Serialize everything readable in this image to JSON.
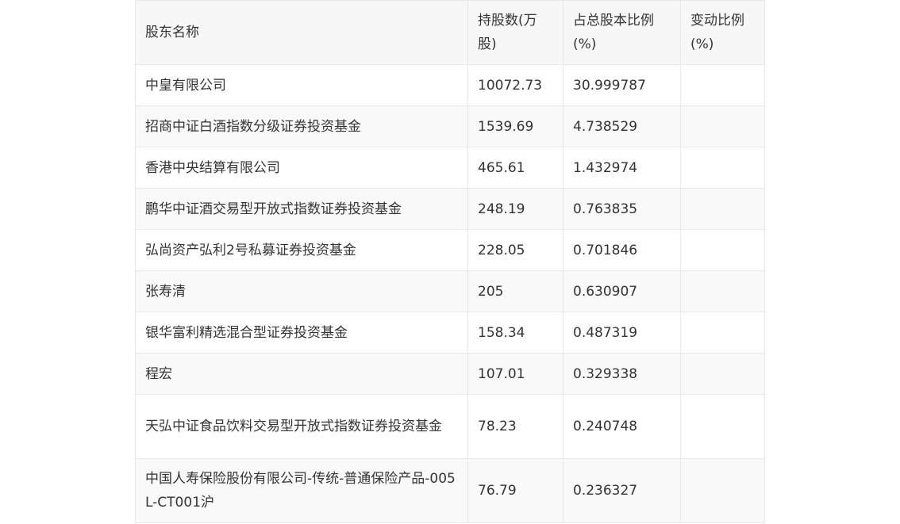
{
  "table": {
    "headers": [
      "股东名称",
      "持股数(万股)",
      "占总股本比例(%)",
      "变动比例(%)"
    ],
    "rows": [
      [
        "中皇有限公司",
        "10072.73",
        "30.999787",
        ""
      ],
      [
        "招商中证白酒指数分级证券投资基金",
        "1539.69",
        "4.738529",
        ""
      ],
      [
        "香港中央结算有限公司",
        "465.61",
        "1.432974",
        ""
      ],
      [
        "鹏华中证酒交易型开放式指数证券投资基金",
        "248.19",
        "0.763835",
        ""
      ],
      [
        "弘尚资产弘利2号私募证券投资基金",
        "228.05",
        "0.701846",
        ""
      ],
      [
        "张寿清",
        "205",
        "0.630907",
        ""
      ],
      [
        "银华富利精选混合型证券投资基金",
        "158.34",
        "0.487319",
        ""
      ],
      [
        "程宏",
        "107.01",
        "0.329338",
        ""
      ],
      [
        "天弘中证食品饮料交易型开放式指数证券投资基金",
        "78.23",
        "0.240748",
        ""
      ],
      [
        "中国人寿保险股份有限公司-传统-普通保险产品-005L-CT001沪",
        "76.79",
        "0.236327",
        ""
      ]
    ]
  }
}
